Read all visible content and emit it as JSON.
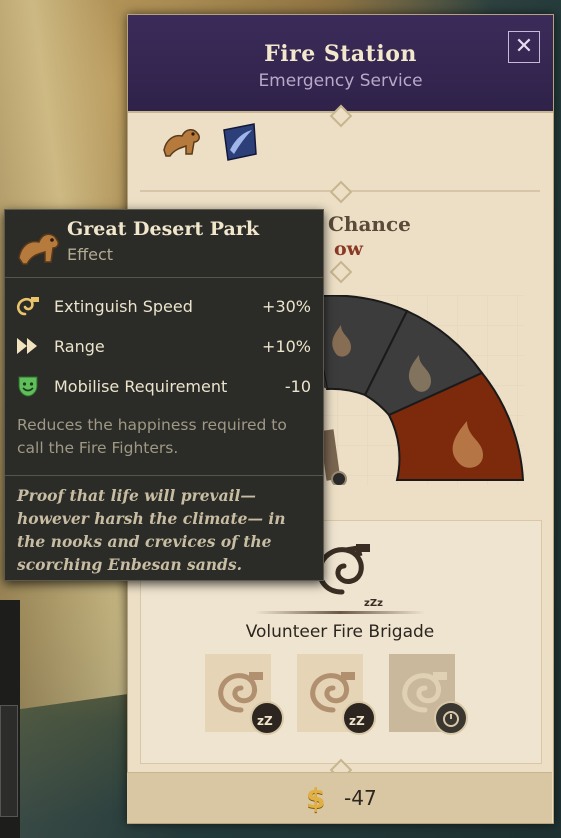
{
  "panel": {
    "title": "Fire Station",
    "subtitle": "Emergency Service",
    "close_label": "✕",
    "effects": [
      {
        "name": "camel-icon"
      },
      {
        "name": "shield-icon"
      }
    ],
    "chance_title": "Chance",
    "chance_value": "ow",
    "brigade_title": "Volunteer Fire Brigade",
    "brigade_slots": [
      {
        "state": "sleeping",
        "badge": "zzz-icon"
      },
      {
        "state": "sleeping",
        "badge": "zzz-icon"
      },
      {
        "state": "active",
        "badge": "timer-icon"
      }
    ],
    "cost_symbol": "$",
    "cost_value": "-47"
  },
  "tooltip": {
    "title": "Great Desert Park",
    "subtitle": "Effect",
    "stats": [
      {
        "label": "Extinguish Speed",
        "value": "+30%",
        "icon": "hose-icon"
      },
      {
        "label": "Range",
        "value": "+10%",
        "icon": "range-arrows-icon"
      },
      {
        "label": "Mobilise Requirement",
        "value": "-10",
        "icon": "happy-mask-icon"
      }
    ],
    "description": "Reduces the happiness required to call the Fire Fighters.",
    "flavor": "Proof that life will prevail— however harsh the climate— in the nooks and crevices of the scorching Enbesan sands."
  },
  "colors": {
    "header_purple": "#2f2249",
    "panel_parchment": "#ecdfc6",
    "tooltip_bg": "#2b2c27",
    "fire_red": "#7c2a0b",
    "wheel_dark": "#3a3a3a",
    "gold": "#e2b042"
  }
}
